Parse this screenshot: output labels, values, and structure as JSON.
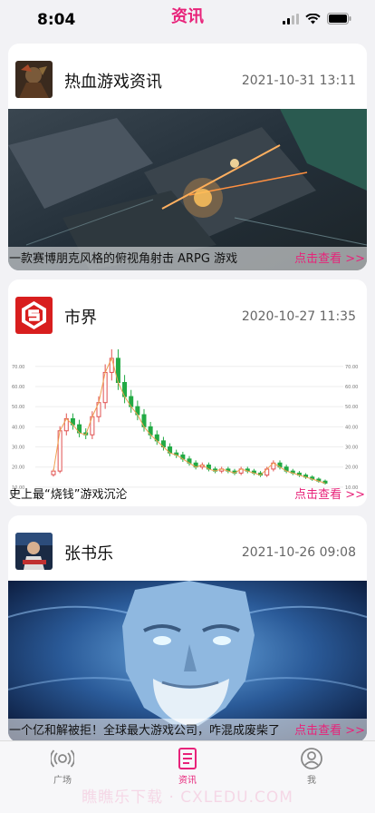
{
  "status_bar": {
    "time": "8:04"
  },
  "nav": {
    "title": "资讯"
  },
  "posts": [
    {
      "author": "热血游戏资讯",
      "date": "2021-10-31 13:11",
      "caption": "一款赛博朋克风格的俯视角射击 ARPG 游戏",
      "more": "点击查看 >>"
    },
    {
      "author": "市界",
      "date": "2020-10-27 11:35",
      "caption": "史上最“烧钱”游戏沉沦",
      "more": "点击查看 >>"
    },
    {
      "author": "张书乐",
      "date": "2021-10-26 09:08",
      "caption": "一个亿和解被拒！全球最大游戏公司，咋混成废柴了",
      "more": "点击查看 >>"
    }
  ],
  "chart_data": {
    "type": "candlestick",
    "y_ticks": [
      "70.00",
      "60.00",
      "50.00",
      "40.00",
      "30.00",
      "20.00",
      "10.00"
    ],
    "ylim": [
      5,
      78
    ],
    "values": [
      18,
      38,
      44,
      41,
      37,
      36,
      45,
      52,
      67,
      74,
      62,
      55,
      50,
      46,
      40,
      36,
      33,
      30,
      27,
      26,
      24,
      22,
      20,
      21,
      19,
      18,
      19,
      18,
      17,
      19,
      18,
      17,
      16,
      19,
      22,
      20,
      18,
      17,
      16,
      15,
      14,
      13,
      12
    ]
  },
  "tab_bar": {
    "tabs": [
      {
        "label": "广场",
        "icon": "broadcast-icon",
        "active": false
      },
      {
        "label": "资讯",
        "icon": "news-icon",
        "active": true
      },
      {
        "label": "我",
        "icon": "user-icon",
        "active": false
      }
    ]
  },
  "watermark": "瞧瞧乐下载 · CXLEDU.COM",
  "colors": {
    "accent": "#e8237a",
    "secondary_text": "#666666"
  }
}
